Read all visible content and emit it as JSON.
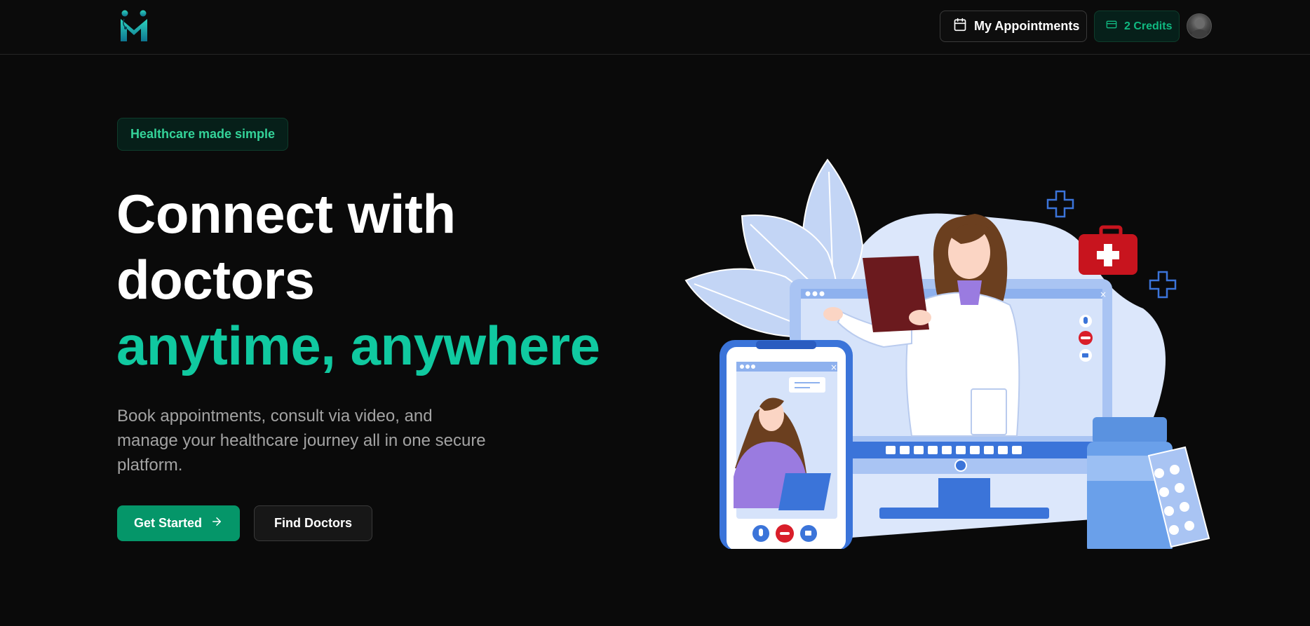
{
  "header": {
    "logo_icon": "medical-logo-icon",
    "appointments": {
      "icon": "calendar-icon",
      "label": "My Appointments"
    },
    "credits": {
      "icon": "credit-card-icon",
      "label": "2 Credits"
    },
    "avatar_icon": "user-avatar"
  },
  "hero": {
    "badge": "Healthcare made simple",
    "headline_line1": "Connect with",
    "headline_line2": "doctors",
    "headline_accent": "anytime, anywhere",
    "subtext": "Book appointments, consult via video, and manage your healthcare journey all in one secure platform.",
    "primary_button": {
      "label": "Get Started",
      "icon": "arrow-right-icon"
    },
    "secondary_button": {
      "label": "Find Doctors"
    }
  },
  "illustration": {
    "subject": "telemedicine-video-call-illustration"
  },
  "colors": {
    "background": "#0a0a0a",
    "accent": "#10c9a0",
    "primary_button": "#059669",
    "badge_text": "#34d399",
    "muted_text": "#a3a3a3"
  }
}
